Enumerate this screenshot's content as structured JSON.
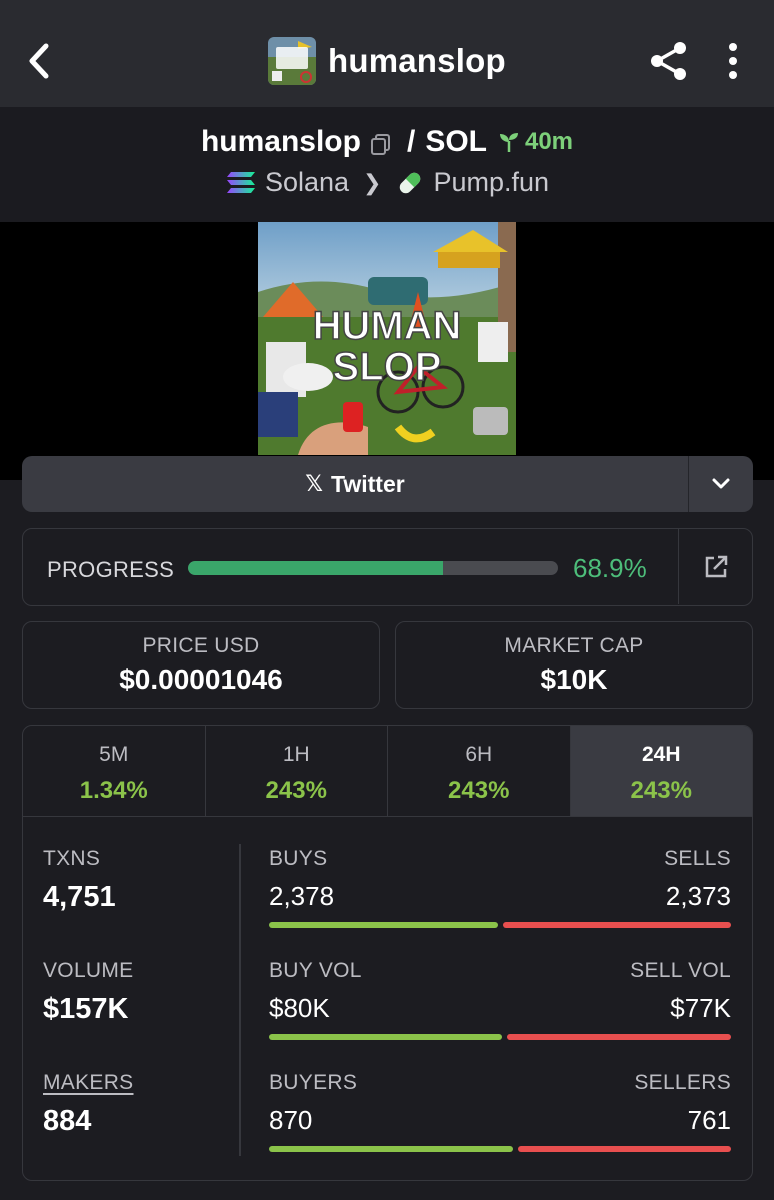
{
  "header": {
    "title": "humanslop",
    "back_icon": "chevron-left-icon",
    "share_icon": "share-icon",
    "menu_icon": "more-vertical-icon"
  },
  "pair": {
    "base": "humanslop",
    "separator": "/",
    "quote": "SOL",
    "age": "40m",
    "chain": "Solana",
    "dex": "Pump.fun"
  },
  "artwork": {
    "line1": "HUMAN",
    "line2": "SLOP"
  },
  "links": {
    "twitter_label": "Twitter"
  },
  "progress": {
    "label": "PROGRESS",
    "value_text": "68.9%",
    "fraction": 0.689
  },
  "price": {
    "label": "PRICE USD",
    "value": "$0.00001046"
  },
  "market_cap": {
    "label": "MARKET CAP",
    "value": "$10K"
  },
  "timeframes": [
    {
      "label": "5M",
      "change": "1.34%"
    },
    {
      "label": "1H",
      "change": "243%"
    },
    {
      "label": "6H",
      "change": "243%"
    },
    {
      "label": "24H",
      "change": "243%",
      "active": true
    }
  ],
  "stats": {
    "txns": {
      "label": "TXNS",
      "value": "4,751"
    },
    "volume": {
      "label": "VOLUME",
      "value": "$157K"
    },
    "makers": {
      "label": "MAKERS",
      "value": "884"
    },
    "buys": {
      "label": "BUYS",
      "value": "2,378",
      "num": 2378
    },
    "sells": {
      "label": "SELLS",
      "value": "2,373",
      "num": 2373
    },
    "buy_vol": {
      "label": "BUY VOL",
      "value": "$80K",
      "num": 80
    },
    "sell_vol": {
      "label": "SELL VOL",
      "value": "$77K",
      "num": 77
    },
    "buyers": {
      "label": "BUYERS",
      "value": "870",
      "num": 870
    },
    "sellers": {
      "label": "SELLERS",
      "value": "761",
      "num": 761
    }
  },
  "colors": {
    "positive": "#8bc34a",
    "negative": "#e84f4f",
    "progress": "#3aa66a"
  }
}
